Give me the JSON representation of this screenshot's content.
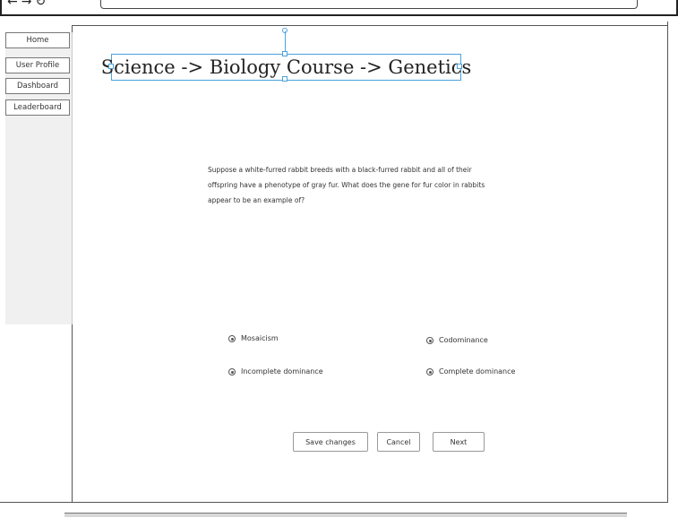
{
  "browser": {
    "back_icon": "arrow-left-icon",
    "forward_icon": "arrow-right-icon",
    "refresh_icon": "refresh-icon"
  },
  "sidebar": {
    "items": [
      {
        "label": "Home"
      },
      {
        "label": "User Profile"
      },
      {
        "label": "Dashboard"
      },
      {
        "label": "Leaderboard"
      }
    ]
  },
  "main": {
    "title": "Science -> Biology Course -> Genetics",
    "question": "Suppose a white-furred rabbit breeds with a black-furred rabbit and all of their offspring have a phenotype of gray fur. What does the gene for fur color in rabbits appear to be an example of?",
    "options": [
      {
        "label": "Mosaicism"
      },
      {
        "label": "Codominance"
      },
      {
        "label": "Incomplete dominance"
      },
      {
        "label": "Complete dominance"
      }
    ],
    "buttons": {
      "save": "Save changes",
      "cancel": "Cancel",
      "next": "Next"
    }
  },
  "colors": {
    "selection": "#4aa3df",
    "border": "#555555"
  }
}
